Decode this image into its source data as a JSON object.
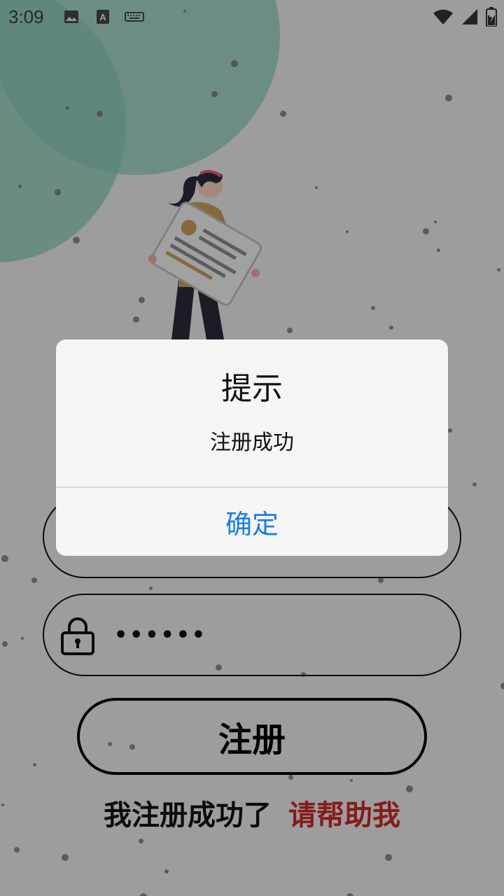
{
  "status_bar": {
    "time": "3:09",
    "left_icons": [
      "image-icon",
      "text-a-icon",
      "keyboard-icon"
    ],
    "right_icons": [
      "wifi-icon",
      "signal-icon",
      "battery-icon"
    ]
  },
  "form": {
    "password_value": "••••••",
    "register_button_label": "注册",
    "bottom_text": "我注册成功了",
    "help_link": "请帮助我"
  },
  "dialog": {
    "title": "提示",
    "message": "注册成功",
    "ok_label": "确定"
  },
  "colors": {
    "link_red": "#c62828",
    "dialog_button_blue": "#1a7fe0",
    "blob_teal": "#9ccfc3"
  }
}
